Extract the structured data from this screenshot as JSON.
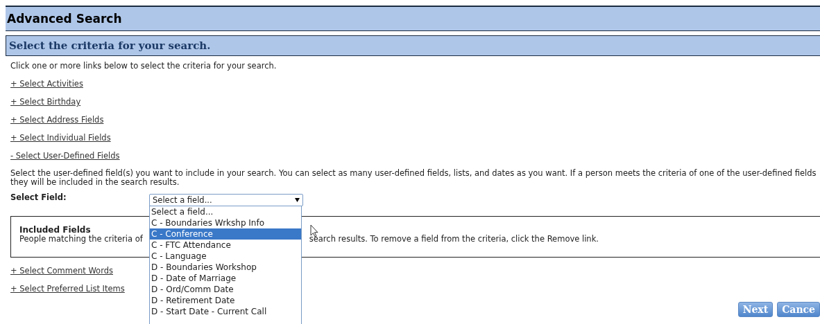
{
  "header": {
    "title": "Advanced Search"
  },
  "section": {
    "title": "Select the criteria for your search."
  },
  "intro": "Click one or more links below to select the criteria for your search.",
  "criteria_links": [
    "+ Select Activities",
    "+ Select Birthday",
    "+ Select Address Fields",
    "+ Select Individual Fields",
    "- Select User-Defined Fields"
  ],
  "user_defined": {
    "description": "Select the user-defined field(s) you want to include in your search. You can select as many user-defined fields, lists, and dates as you want. If a person meets the criteria of one of the user-defined fields they will be included in the search results.",
    "select_label": "Select Field:",
    "select_value": "Select a field...",
    "dropdown_options": [
      {
        "label": "Select a field...",
        "selected": false
      },
      {
        "label": "C - Boundaries Wrkshp Info",
        "selected": false
      },
      {
        "label": "C - Conference",
        "selected": true
      },
      {
        "label": "C - FTC Attendance",
        "selected": false
      },
      {
        "label": "C - Language",
        "selected": false
      },
      {
        "label": "D - Boundaries Workshop",
        "selected": false
      },
      {
        "label": "D - Date of Marriage",
        "selected": false
      },
      {
        "label": "D - Ord/Comm Date",
        "selected": false
      },
      {
        "label": "D - Retirement Date",
        "selected": false
      },
      {
        "label": "D - Start Date - Current Call",
        "selected": false
      }
    ]
  },
  "included_fields": {
    "title": "Included Fields",
    "text_before": "People matching the criteria of",
    "text_after": "search results. To remove a field from the criteria, click the Remove link."
  },
  "more_links": [
    "+ Select Comment Words",
    "+ Select Preferred List Items"
  ],
  "buttons": [
    "Next",
    "Cance"
  ]
}
